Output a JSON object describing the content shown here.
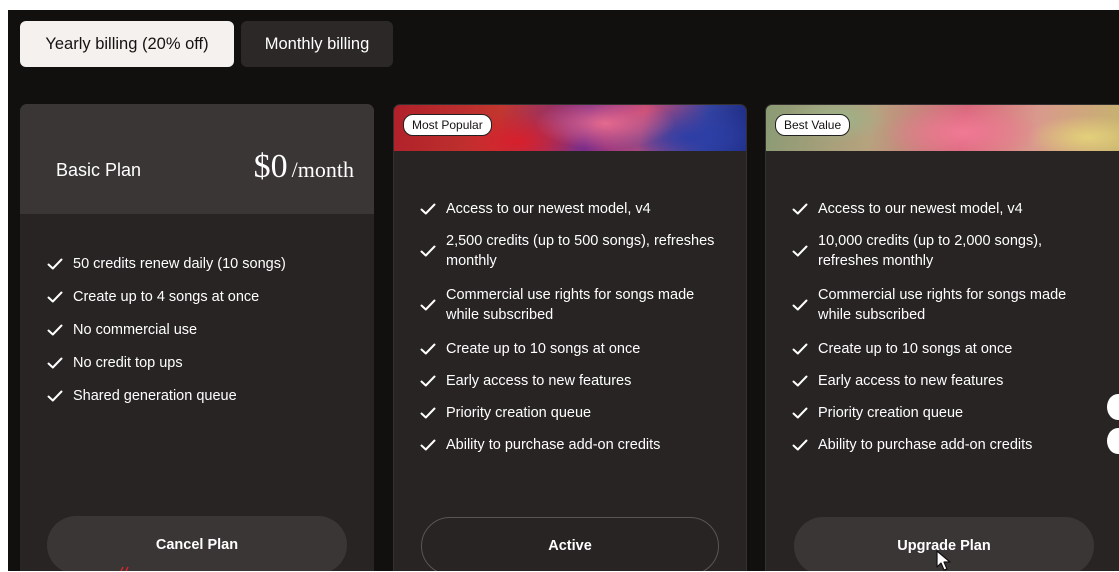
{
  "billing": {
    "yearly_label": "Yearly billing (20% off)",
    "monthly_label": "Monthly billing"
  },
  "plans": [
    {
      "name": "Basic Plan",
      "price": "$0",
      "period": "/month",
      "features": [
        "50 credits renew daily (10 songs)",
        "Create up to 4 songs at once",
        "No commercial use",
        "No credit top ups",
        "Shared generation queue"
      ],
      "cta": "Cancel Plan"
    },
    {
      "badge": "Most Popular",
      "features": [
        "Access to our newest model, v4",
        "2,500 credits (up to 500 songs), refreshes monthly",
        "Commercial use rights for songs made while subscribed",
        "Create up to 10 songs at once",
        "Early access to new features",
        "Priority creation queue",
        "Ability to purchase add-on credits"
      ],
      "cta": "Active"
    },
    {
      "badge": "Best Value",
      "features": [
        "Access to our newest model, v4",
        "10,000 credits (up to 2,000 songs), refreshes monthly",
        "Commercial use rights for songs made while subscribed",
        "Create up to 10 songs at once",
        "Early access to new features",
        "Priority creation queue",
        "Ability to purchase add-on credits"
      ],
      "cta": "Upgrade Plan"
    }
  ],
  "icons": {
    "feature": "check-icon",
    "pointer": "mouse-cursor-icon"
  },
  "colors": {
    "background": "#120f0f",
    "card": "#272423",
    "toggle_active": "#f4f1ee",
    "toggle_inactive": "#2b2827"
  }
}
